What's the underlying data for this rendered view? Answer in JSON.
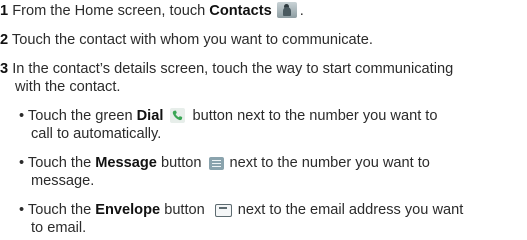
{
  "steps": [
    {
      "number": "1",
      "before": "From the Home screen, touch",
      "bold": "Contacts",
      "after": "."
    },
    {
      "number": "2",
      "text": "Touch the contact with whom you want to communicate."
    },
    {
      "number": "3",
      "line1": "In the contact’s details screen, touch the way to start communicating",
      "line2": "with the contact."
    }
  ],
  "bullets": [
    {
      "lead": "• Touch the green",
      "bold": "Dial",
      "trail": "button next to the number you want to",
      "cont": "call to automatically."
    },
    {
      "lead": "• Touch the",
      "bold": "Message",
      "trail": "button",
      "trail2": "next to the number you want to",
      "cont": "message."
    },
    {
      "lead": "• Touch the",
      "bold": "Envelope",
      "trail": "button",
      "trail2": "next to the email address you want",
      "cont": "to email."
    }
  ],
  "icons": {
    "contacts": "contacts-app-icon",
    "dial": "phone-dial-icon",
    "message": "message-icon",
    "envelope": "envelope-icon"
  },
  "colors": {
    "text": "#2b2b2b",
    "dial_green": "#3aa655"
  }
}
